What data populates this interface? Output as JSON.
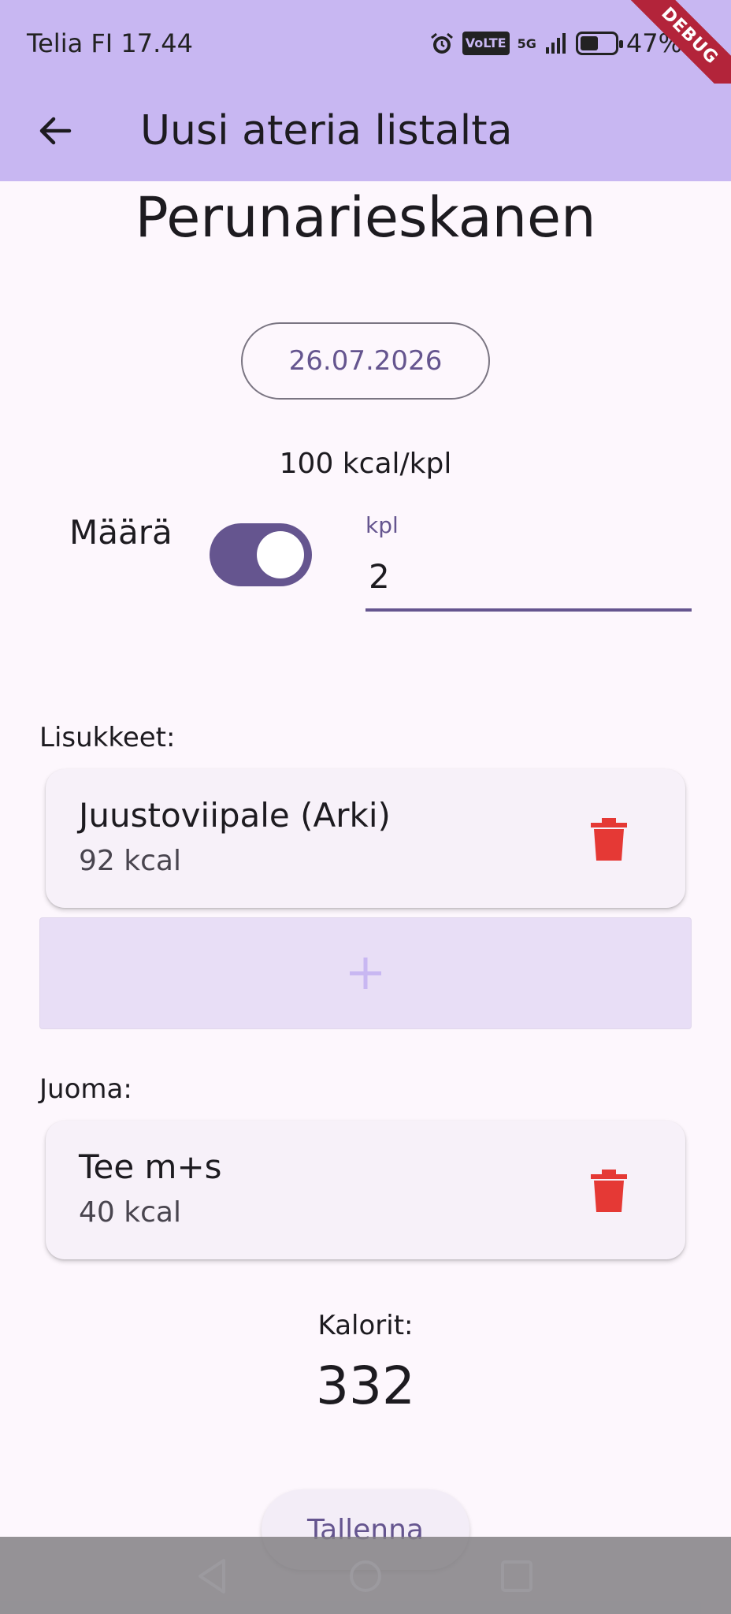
{
  "status_bar": {
    "carrier_time": "Telia FI 17.44",
    "volte": "VoLTE",
    "network": "5G",
    "battery": "47%",
    "battery_level": 0.47,
    "debug_label": "DEBUG"
  },
  "app_bar": {
    "title": "Uusi ateria listalta",
    "back_icon": "arrow-back-icon"
  },
  "meal": {
    "name": "Perunarieskanen",
    "date": "26.07.2026",
    "kcal_per_unit": "100 kcal/kpl",
    "amount_label": "Määrä",
    "amount_switch_on": true,
    "unit_label": "kpl",
    "quantity": "2"
  },
  "sides": {
    "label": "Lisukkeet:",
    "items": [
      {
        "name": "Juustoviipale (Arki)",
        "kcal": "92 kcal"
      }
    ],
    "add_icon": "plus-icon"
  },
  "drink": {
    "label": "Juoma:",
    "items": [
      {
        "name": "Tee m+s",
        "kcal": "40 kcal"
      }
    ]
  },
  "calories": {
    "label": "Kalorit:",
    "value": "332"
  },
  "save": {
    "label": "Tallenna"
  },
  "colors": {
    "app_bar": "#c8b7f2",
    "primary": "#65558f",
    "delete": "#e53935",
    "background": "#fdf7fd"
  }
}
